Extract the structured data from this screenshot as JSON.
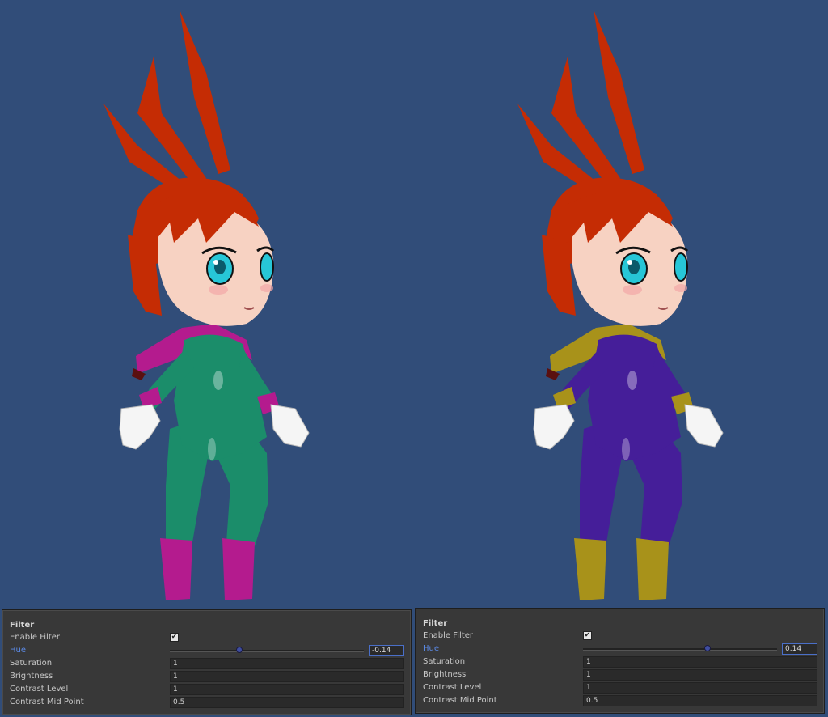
{
  "colors": {
    "background": "#314d79",
    "hair": "#c52c04",
    "skin": "#f7d2c2",
    "eye": "#27c6d7",
    "gloves": "#f5f5f5",
    "left_suit": "#1b8d6a",
    "left_trim": "#b41b8e",
    "right_suit": "#451e99",
    "right_trim": "#a8921a",
    "panel_bg": "#383838",
    "hue_label": "#5b8ae6"
  },
  "panels": [
    {
      "title": "Filter",
      "enable_filter_label": "Enable Filter",
      "enable_filter_checked": true,
      "checkmark": "✔",
      "hue_label": "Hue",
      "hue_value": "-0.14",
      "hue_slider_fraction": 0.36,
      "saturation_label": "Saturation",
      "saturation_value": "1",
      "brightness_label": "Brightness",
      "brightness_value": "1",
      "contrast_level_label": "Contrast Level",
      "contrast_level_value": "1",
      "contrast_mid_label": "Contrast Mid Point",
      "contrast_mid_value": "0.5"
    },
    {
      "title": "Filter",
      "enable_filter_label": "Enable Filter",
      "enable_filter_checked": true,
      "checkmark": "✔",
      "hue_label": "Hue",
      "hue_value": "0.14",
      "hue_slider_fraction": 0.64,
      "saturation_label": "Saturation",
      "saturation_value": "1",
      "brightness_label": "Brightness",
      "brightness_value": "1",
      "contrast_level_label": "Contrast Level",
      "contrast_level_value": "1",
      "contrast_mid_label": "Contrast Mid Point",
      "contrast_mid_value": "0.5"
    }
  ]
}
